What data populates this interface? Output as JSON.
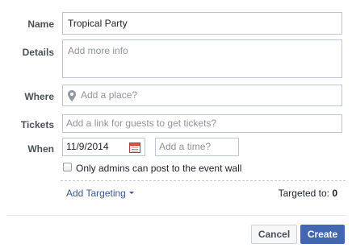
{
  "form": {
    "name": {
      "label": "Name",
      "value": "Tropical Party"
    },
    "details": {
      "label": "Details",
      "placeholder": "Add more info"
    },
    "where": {
      "label": "Where",
      "placeholder": "Add a place?",
      "icon": "map-pin-icon"
    },
    "tickets": {
      "label": "Tickets",
      "placeholder": "Add a link for guests to get tickets?"
    },
    "when": {
      "label": "When",
      "date": "11/9/2014",
      "time_placeholder": "Add a time?",
      "icon": "calendar-icon"
    },
    "admins_only": {
      "label": "Only admins can post to the event wall",
      "checked": false
    }
  },
  "targeting": {
    "link_label": "Add Targeting",
    "targeted_label": "Targeted to:",
    "targeted_count": "0"
  },
  "actions": {
    "cancel_label": "Cancel",
    "create_label": "Create"
  },
  "colors": {
    "primary": "#4267b2",
    "link": "#365899",
    "border": "#bdc7d8",
    "label": "#4b4f56"
  }
}
